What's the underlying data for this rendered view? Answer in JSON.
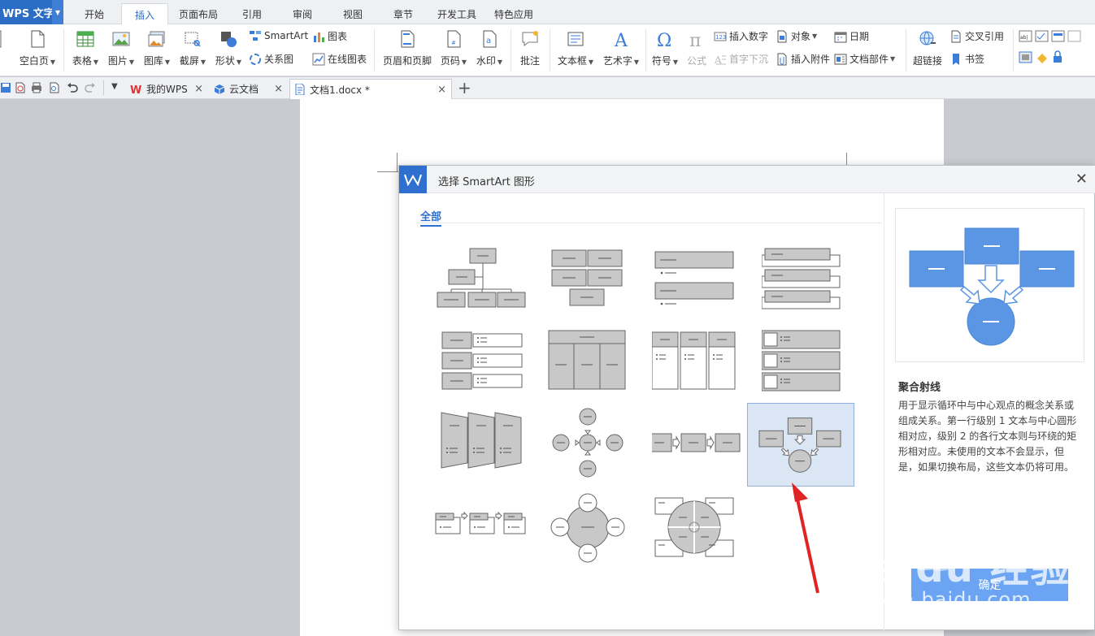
{
  "app": {
    "name": "WPS 文字"
  },
  "ribbon_tabs": [
    "开始",
    "插入",
    "页面布局",
    "引用",
    "审阅",
    "视图",
    "章节",
    "开发工具",
    "特色应用"
  ],
  "active_tab": "插入",
  "ribbon": {
    "blank_page": "空白页",
    "table": "表格",
    "picture": "图片",
    "gallery": "图库",
    "screenshot": "截屏",
    "shape": "形状",
    "smartart": "SmartArt",
    "chart": "图表",
    "relation": "关系图",
    "online_chart": "在线图表",
    "header_footer": "页眉和页脚",
    "page_number": "页码",
    "watermark": "水印",
    "comment": "批注",
    "textbox": "文本框",
    "wordart": "艺术字",
    "symbol": "符号",
    "formula": "公式",
    "insert_number": "插入数字",
    "drop_cap": "首字下沉",
    "object": "对象",
    "attachment": "插入附件",
    "date": "日期",
    "doc_parts": "文档部件",
    "cross_ref": "交叉引用",
    "hyperlink": "超链接",
    "bookmark": "书签"
  },
  "doc_tabs": [
    {
      "label": "我的WPS"
    },
    {
      "label": "云文档"
    },
    {
      "label": "文档1.docx *"
    }
  ],
  "dialog": {
    "title": "选择 SmartArt 图形",
    "category": "全部",
    "selected_name": "聚合射线",
    "selected_desc": "用于显示循环中与中心观点的概念关系或组成关系。第一行级别 1 文本与中心圆形相对应，级别 2 的各行文本则与环绕的矩形相对应。未使用的文本不会显示，但是，如果切换布局，这些文本仍将可用。",
    "ok_label": "确定"
  },
  "watermark": {
    "logo": "Baidu 经验",
    "url": "jingyan.baidu.com"
  },
  "colors": {
    "accent": "#2f6fcf",
    "shape_blue": "#5a96e3",
    "shape_gray": "#c8c8c8"
  }
}
